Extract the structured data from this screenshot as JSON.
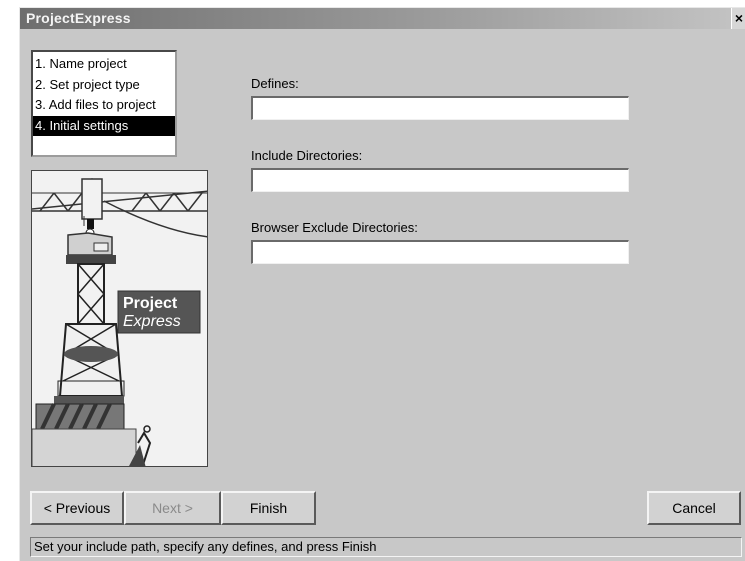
{
  "window": {
    "title": "ProjectExpress",
    "close_label": "×"
  },
  "steps": [
    {
      "label": "1. Name project",
      "selected": false
    },
    {
      "label": "2. Set project type",
      "selected": false
    },
    {
      "label": "3. Add files to project",
      "selected": false
    },
    {
      "label": "4. Initial settings",
      "selected": true
    }
  ],
  "illustration": {
    "logo_line1": "Project",
    "logo_line2": "Express"
  },
  "fields": {
    "defines": {
      "label": "Defines:",
      "value": ""
    },
    "include_dirs": {
      "label": "Include Directories:",
      "value": ""
    },
    "browser_exclude": {
      "label": "Browser Exclude Directories:",
      "value": ""
    }
  },
  "buttons": {
    "previous": "< Previous",
    "next": "Next >",
    "finish": "Finish",
    "cancel": "Cancel"
  },
  "status": {
    "text": "Set your include path, specify any defines, and press Finish"
  }
}
